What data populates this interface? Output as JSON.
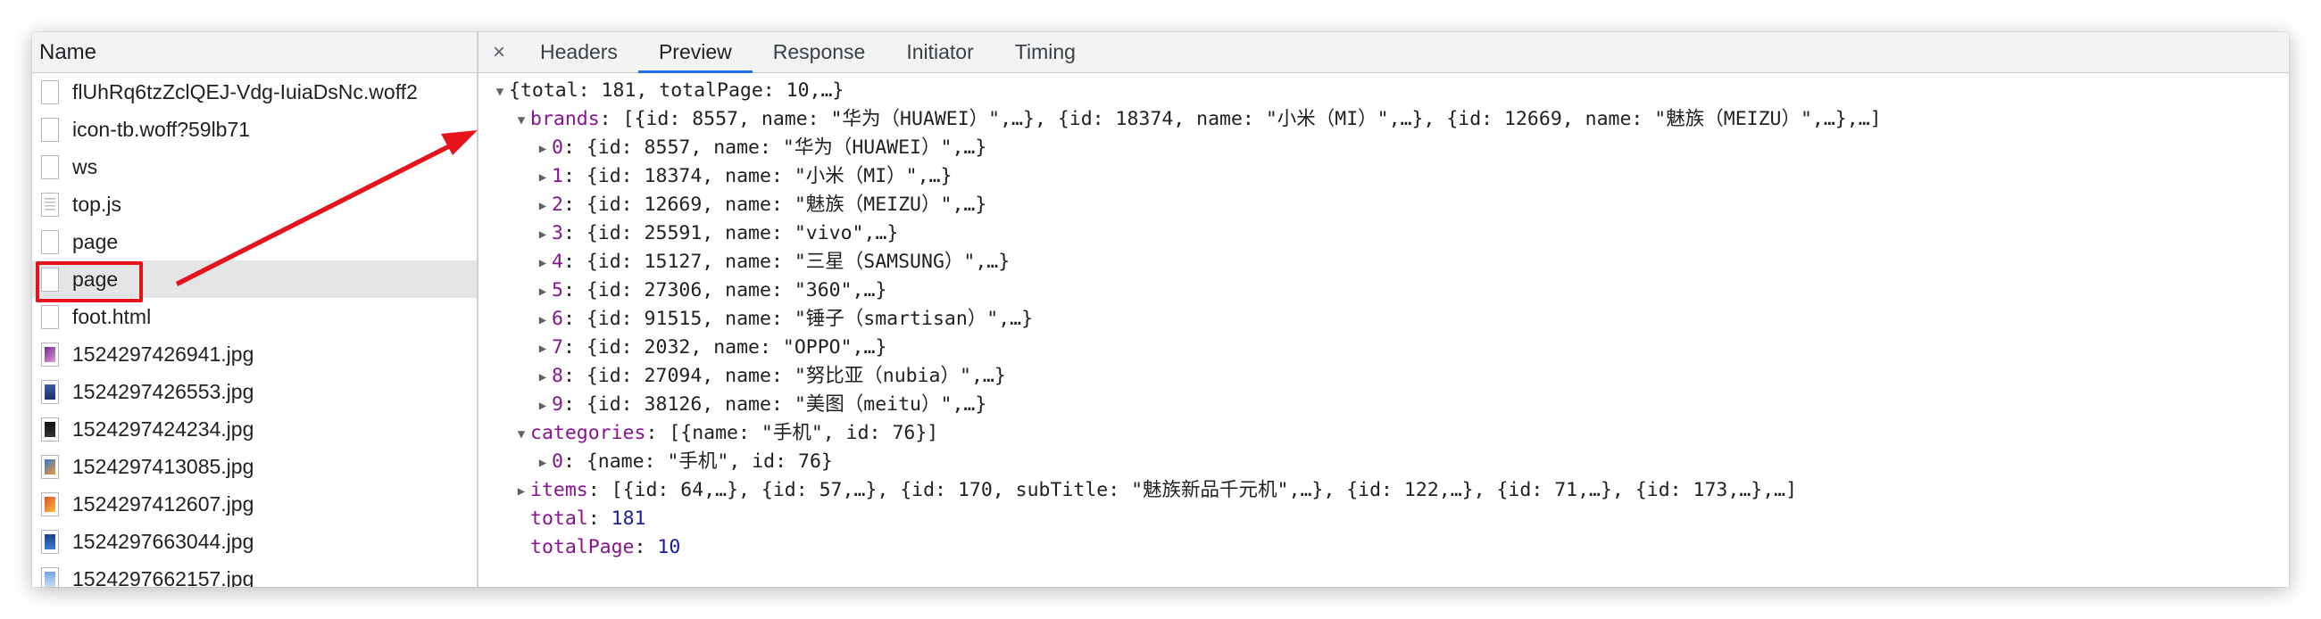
{
  "left_panel": {
    "header": "Name",
    "files": [
      {
        "name": "flUhRq6tzZclQEJ-Vdg-IuiaDsNc.woff2",
        "icon": "doc",
        "thumb": ""
      },
      {
        "name": "icon-tb.woff?59lb71",
        "icon": "doc",
        "thumb": ""
      },
      {
        "name": "ws",
        "icon": "doc",
        "thumb": ""
      },
      {
        "name": "top.js",
        "icon": "script",
        "thumb": ""
      },
      {
        "name": "page",
        "icon": "doc",
        "thumb": ""
      },
      {
        "name": "page",
        "icon": "doc",
        "thumb": "",
        "selected": true
      },
      {
        "name": "foot.html",
        "icon": "doc",
        "thumb": ""
      },
      {
        "name": "1524297426941.jpg",
        "icon": "img",
        "thumb": "linear-gradient(135deg,#6b2a8f,#e79ad5)"
      },
      {
        "name": "1524297426553.jpg",
        "icon": "img",
        "thumb": "linear-gradient(180deg,#3c5ea8,#1f2e66)"
      },
      {
        "name": "1524297424234.jpg",
        "icon": "img",
        "thumb": "linear-gradient(180deg,#111111,#333333)"
      },
      {
        "name": "1524297413085.jpg",
        "icon": "img",
        "thumb": "linear-gradient(135deg,#2f74d0,#f39c32)"
      },
      {
        "name": "1524297412607.jpg",
        "icon": "img",
        "thumb": "linear-gradient(135deg,#e04b2c,#f5c23c)"
      },
      {
        "name": "1524297663044.jpg",
        "icon": "img",
        "thumb": "linear-gradient(180deg,#1b3f8a,#3b79d4)"
      },
      {
        "name": "1524297662157.jpg",
        "icon": "img",
        "thumb": "linear-gradient(180deg,#6fa6e3,#c9ddf5)"
      }
    ]
  },
  "tabs": {
    "close": "×",
    "items": [
      "Headers",
      "Preview",
      "Response",
      "Initiator",
      "Timing"
    ],
    "active": "Preview"
  },
  "preview": {
    "lines": [
      {
        "indent": 0,
        "toggle": "open",
        "parts": [
          {
            "t": "{total: 181, totalPage: 10,…}",
            "c": ""
          }
        ]
      },
      {
        "indent": 1,
        "toggle": "open",
        "parts": [
          {
            "t": "brands",
            "c": "k"
          },
          {
            "t": ": [{id: 8557, name: \"华为（HUAWEI）\",…}, {id: 18374, name: \"小米（MI）\",…}, {id: 12669, name: \"魅族（MEIZU）\",…},…]",
            "c": ""
          }
        ]
      },
      {
        "indent": 2,
        "toggle": "closed",
        "parts": [
          {
            "t": "0",
            "c": "k"
          },
          {
            "t": ": {id: 8557, name: \"华为（HUAWEI）\",…}",
            "c": ""
          }
        ]
      },
      {
        "indent": 2,
        "toggle": "closed",
        "parts": [
          {
            "t": "1",
            "c": "k"
          },
          {
            "t": ": {id: 18374, name: \"小米（MI）\",…}",
            "c": ""
          }
        ]
      },
      {
        "indent": 2,
        "toggle": "closed",
        "parts": [
          {
            "t": "2",
            "c": "k"
          },
          {
            "t": ": {id: 12669, name: \"魅族（MEIZU）\",…}",
            "c": ""
          }
        ]
      },
      {
        "indent": 2,
        "toggle": "closed",
        "parts": [
          {
            "t": "3",
            "c": "k"
          },
          {
            "t": ": {id: 25591, name: \"vivo\",…}",
            "c": ""
          }
        ]
      },
      {
        "indent": 2,
        "toggle": "closed",
        "parts": [
          {
            "t": "4",
            "c": "k"
          },
          {
            "t": ": {id: 15127, name: \"三星（SAMSUNG）\",…}",
            "c": ""
          }
        ]
      },
      {
        "indent": 2,
        "toggle": "closed",
        "parts": [
          {
            "t": "5",
            "c": "k"
          },
          {
            "t": ": {id: 27306, name: \"360\",…}",
            "c": ""
          }
        ]
      },
      {
        "indent": 2,
        "toggle": "closed",
        "parts": [
          {
            "t": "6",
            "c": "k"
          },
          {
            "t": ": {id: 91515, name: \"锤子（smartisan）\",…}",
            "c": ""
          }
        ]
      },
      {
        "indent": 2,
        "toggle": "closed",
        "parts": [
          {
            "t": "7",
            "c": "k"
          },
          {
            "t": ": {id: 2032, name: \"OPPO\",…}",
            "c": ""
          }
        ]
      },
      {
        "indent": 2,
        "toggle": "closed",
        "parts": [
          {
            "t": "8",
            "c": "k"
          },
          {
            "t": ": {id: 27094, name: \"努比亚（nubia）\",…}",
            "c": ""
          }
        ]
      },
      {
        "indent": 2,
        "toggle": "closed",
        "parts": [
          {
            "t": "9",
            "c": "k"
          },
          {
            "t": ": {id: 38126, name: \"美图（meitu）\",…}",
            "c": ""
          }
        ]
      },
      {
        "indent": 1,
        "toggle": "open",
        "parts": [
          {
            "t": "categories",
            "c": "k"
          },
          {
            "t": ": [{name: \"手机\", id: 76}]",
            "c": ""
          }
        ]
      },
      {
        "indent": 2,
        "toggle": "closed",
        "parts": [
          {
            "t": "0",
            "c": "k"
          },
          {
            "t": ": {name: \"手机\", id: 76}",
            "c": ""
          }
        ]
      },
      {
        "indent": 1,
        "toggle": "closed",
        "parts": [
          {
            "t": "items",
            "c": "k"
          },
          {
            "t": ": [{id: 64,…}, {id: 57,…}, {id: 170, subTitle: \"魅族新品千元机\",…}, {id: 122,…}, {id: 71,…}, {id: 173,…},…]",
            "c": ""
          }
        ]
      },
      {
        "indent": 1,
        "toggle": "none",
        "parts": [
          {
            "t": "total",
            "c": "k"
          },
          {
            "t": ": ",
            "c": ""
          },
          {
            "t": "181",
            "c": "n"
          }
        ]
      },
      {
        "indent": 1,
        "toggle": "none",
        "parts": [
          {
            "t": "totalPage",
            "c": "k"
          },
          {
            "t": ": ",
            "c": ""
          },
          {
            "t": "10",
            "c": "n"
          }
        ]
      }
    ]
  },
  "colors": {
    "annotation_red": "#e5141c",
    "active_tab_underline": "#1a73e8",
    "key_purple": "#881391",
    "number_blue": "#1a1aa6"
  }
}
